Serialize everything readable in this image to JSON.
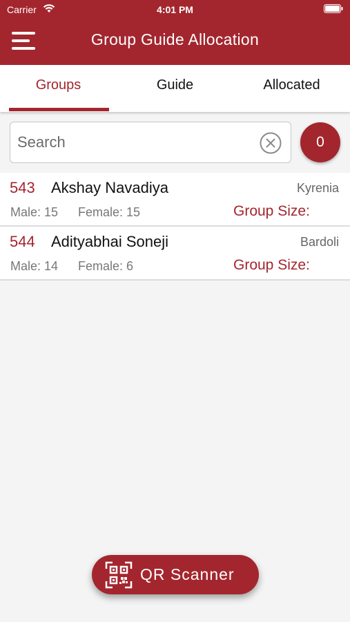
{
  "status_bar": {
    "carrier": "Carrier",
    "time": "4:01 PM"
  },
  "header": {
    "title": "Group Guide Allocation",
    "background_color": "#a3262e"
  },
  "tabs": [
    {
      "label": "Groups",
      "active": true
    },
    {
      "label": "Guide",
      "active": false
    },
    {
      "label": "Allocated",
      "active": false
    }
  ],
  "search": {
    "placeholder": "Search",
    "value": ""
  },
  "count_badge": "0",
  "groups": [
    {
      "id": "543",
      "name": "Akshay Navadiya",
      "location": "Kyrenia",
      "male": "Male: 15",
      "female": "Female: 15",
      "group_size": "Group Size:"
    },
    {
      "id": "544",
      "name": "Adityabhai Soneji",
      "location": "Bardoli",
      "male": "Male: 14",
      "female": "Female: 6",
      "group_size": "Group Size:"
    }
  ],
  "qr_button": {
    "label": "QR Scanner",
    "icon": "qr-code-icon"
  },
  "colors": {
    "accent": "#a3262e",
    "background": "#f4f4f4"
  }
}
